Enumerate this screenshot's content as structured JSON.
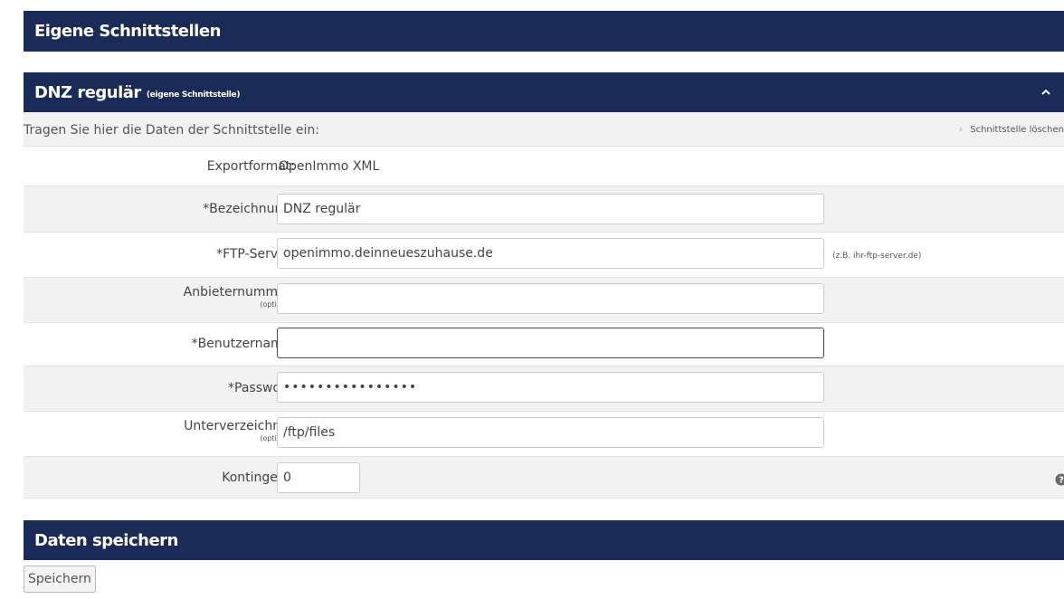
{
  "header": {
    "title": "Eigene Schnittstellen"
  },
  "section": {
    "title": "DNZ regulär",
    "subtitle": "(eigene Schnittstelle)",
    "intro": "Tragen Sie hier die Daten der Schnittstelle ein:",
    "delete_link": "Schnittstelle löschen"
  },
  "form": {
    "exportformat": {
      "label": "Exportformat:",
      "value": "OpenImmo XML"
    },
    "bezeichnung": {
      "label": "*Bezeichnung:",
      "value": "DNZ regulär"
    },
    "ftp_server": {
      "label": "*FTP-Server:",
      "value": "openimmo.deinneueszuhause.de",
      "hint": "(z.B. ihr-ftp-server.de)"
    },
    "anbieternummer": {
      "label": "Anbieternummer:",
      "optional": "(optional)",
      "value": ""
    },
    "benutzername": {
      "label": "*Benutzername:",
      "value": ""
    },
    "passwort": {
      "label": "*Passwort:",
      "value": "••••••••••••••••"
    },
    "unterverzeichnis": {
      "label": "Unterverzeichnis:",
      "optional": "(optional)",
      "value": "/ftp/files"
    },
    "kontingent": {
      "label": "Kontingent:",
      "value": "0"
    }
  },
  "save_section": {
    "title": "Daten speichern",
    "button": "Speichern"
  },
  "colors": {
    "header_bg": "#1b2b57",
    "row_shade": "#f2f2f2"
  },
  "icons": {
    "collapse": "chevron-up-icon",
    "help": "question-circle-icon",
    "delete": "chevron-right-icon"
  }
}
